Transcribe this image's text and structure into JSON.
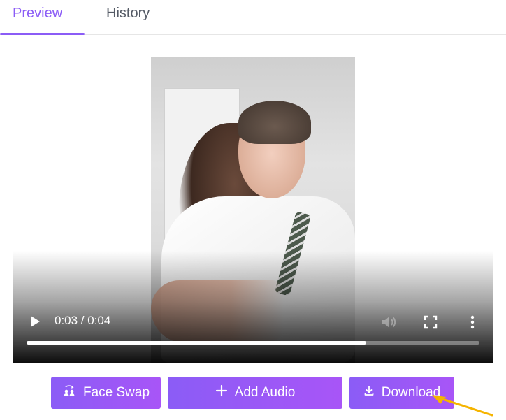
{
  "tabs": [
    {
      "label": "Preview",
      "active": true
    },
    {
      "label": "History",
      "active": false
    }
  ],
  "player": {
    "time_display": "0:03 / 0:04",
    "progress": 0.75,
    "icons": {
      "play": "play-icon",
      "volume": "volume-icon",
      "fullscreen": "fullscreen-icon",
      "more": "more-vertical-icon"
    }
  },
  "actions": {
    "face_swap": {
      "label": "Face Swap",
      "icon": "face-swap-icon"
    },
    "add_audio": {
      "label": "Add Audio",
      "icon": "plus-icon"
    },
    "download": {
      "label": "Download",
      "icon": "download-icon"
    }
  },
  "colors": {
    "accent": "#8b5cf6",
    "accent_end": "#a855f7",
    "tab_inactive": "#555b66",
    "annotation_arrow": "#f5b400"
  }
}
